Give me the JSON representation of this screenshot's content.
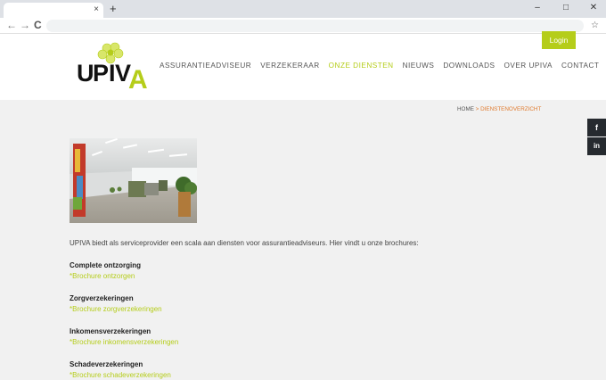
{
  "browser": {
    "new_tab": "+",
    "tab_close": "×",
    "minimize": "–",
    "maximize": "□",
    "close": "✕",
    "back": "←",
    "forward": "→",
    "reload": "C",
    "bookmark": "☆"
  },
  "header": {
    "login_label": "Login",
    "logo_text": "UPIVA",
    "nav": [
      {
        "label": "ASSURANTIEADVISEUR"
      },
      {
        "label": "VERZEKERAAR"
      },
      {
        "label": "ONZE DIENSTEN"
      },
      {
        "label": "NIEUWS"
      },
      {
        "label": "DOWNLOADS"
      },
      {
        "label": "OVER UPIVA"
      },
      {
        "label": "CONTACT"
      }
    ]
  },
  "breadcrumb": {
    "home": "HOME",
    "separator": ">",
    "current": "DIENSTENOVERZICHT"
  },
  "social": {
    "facebook": "f",
    "linkedin": "in"
  },
  "content": {
    "intro": "UPIVA biedt als serviceprovider een scala aan diensten voor assurantieadviseurs. Hier vindt u onze brochures:",
    "services": [
      {
        "title": "Complete ontzorging",
        "link": "*Brochure ontzorgen"
      },
      {
        "title": "Zorgverzekeringen",
        "link": "*Brochure zorgverzekeringen"
      },
      {
        "title": "Inkomensverzekeringen",
        "link": "*Brochure inkomensverzekeringen"
      },
      {
        "title": "Schadeverzekeringen",
        "link": "*Brochure schadeverzekeringen"
      }
    ]
  },
  "colors": {
    "accent": "#b5cd1a",
    "breadcrumb_accent": "#e07a2e",
    "social_bg": "#262a2f",
    "page_bg": "#f1f1f1"
  }
}
